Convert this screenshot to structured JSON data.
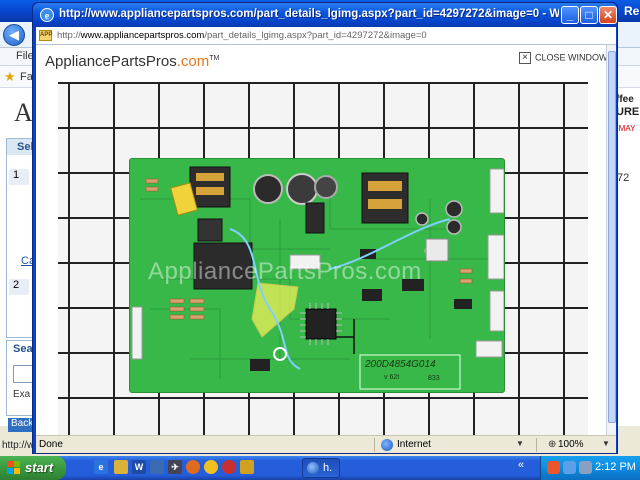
{
  "background_window": {
    "title_fragment": "Re",
    "menu_fragment": "File",
    "favorites_fragment": "Fav",
    "logo_fragment": "Ap",
    "left_panel": {
      "header": "Sel",
      "step1": "1",
      "link": "Ca",
      "step2": "2"
    },
    "search": {
      "label": "Sear",
      "example": "Exa"
    },
    "ad": {
      "line1": "ffee",
      "line2": "URE",
      "line3": "-MAY"
    },
    "right_number": "72",
    "bottom_link": "Back",
    "status_url": "http://w"
  },
  "popup": {
    "title": "http://www.appliancepartspros.com/part_details_lgimg.aspx?part_id=4297272&image=0 - Windo...",
    "address": {
      "prefix": "http://",
      "host": "www.appliancepartspros.com",
      "path": "/part_details_lgimg.aspx?part_id=4297272&image=0",
      "favicon_label": "APP"
    },
    "content": {
      "logo_main": "AppliancePartsPros.com",
      "logo_part1": "AppliancePartsPros",
      "logo_part2": ".com",
      "logo_tm": "TM",
      "close_label": "CLOSE WINDOW",
      "close_glyph": "×",
      "watermark": "AppliancePartsPros.com",
      "board_code": "200D4854G014",
      "board_rev": "v 62t",
      "board_num": "833"
    },
    "status": {
      "left": "Done",
      "zone": "Internet",
      "zoom": "100%"
    }
  },
  "taskbar": {
    "start_label": "start",
    "task_label": "h.",
    "clock": "2:12 PM"
  },
  "colors": {
    "xp_blue": "#245edb",
    "start_green": "#3a9a3f",
    "pcb_green": "#39b84a",
    "brand_orange": "#e8761c"
  },
  "icons": [
    "ie-icon",
    "minimize-icon",
    "maximize-icon",
    "close-icon",
    "globe-icon",
    "zoom-icon",
    "windows-flag-icon"
  ]
}
